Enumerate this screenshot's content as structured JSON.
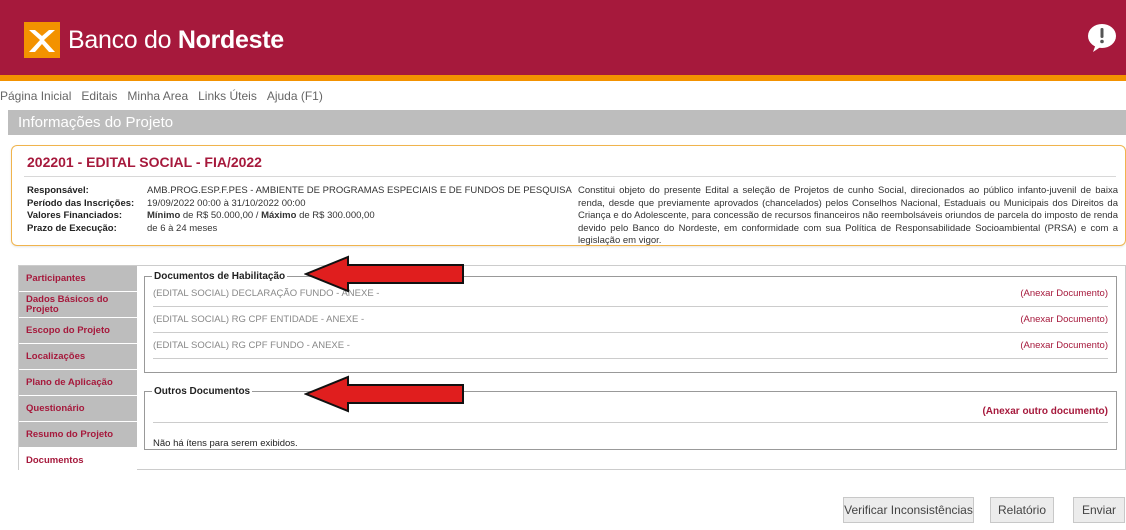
{
  "header": {
    "brand_regular": "Banco do ",
    "brand_bold": "Nordeste",
    "colors": {
      "primary": "#a6193c",
      "accent": "#f39200"
    },
    "help_icon": "speech-bubble-exclamation-icon"
  },
  "menu": {
    "items": [
      "Página Inicial",
      "Editais",
      "Minha Area",
      "Links Úteis",
      "Ajuda (F1)"
    ]
  },
  "page_title": "Informações do Projeto",
  "project": {
    "title": "202201 - EDITAL SOCIAL - FIA/2022",
    "responsavel_label": "Responsável:",
    "responsavel": "AMB.PROG.ESP.F.PES - AMBIENTE DE PROGRAMAS ESPECIAIS E DE FUNDOS DE PESQUISA",
    "periodo_label": "Período das Inscrições:",
    "periodo": "19/09/2022 00:00 à 31/10/2022 00:00",
    "valores_label": "Valores Financiados:",
    "valores_min_label": "Mínimo",
    "valores_min": " de R$ 50.000,00 / ",
    "valores_max_label": "Máximo",
    "valores_max": " de R$ 300.000,00",
    "prazo_label": "Prazo de Execução:",
    "prazo": "de 6 à 24 meses",
    "description": "Constitui objeto do presente Edital a seleção de Projetos de cunho Social, direcionados ao público infanto-juvenil de baixa renda, desde que previamente aprovados (chancelados) pelos Conselhos Nacional, Estaduais ou Municipais dos Direitos da Criança e do Adolescente, para concessão de recursos financeiros não reembolsáveis oriundos de parcela do imposto de renda devido pelo Banco do Nordeste, em conformidade com sua Política de Responsabilidade Socioambiental (PRSA) e com a legislação em vigor."
  },
  "tabs": [
    "Participantes",
    "Dados Básicos do Projeto",
    "Escopo do Projeto",
    "Localizações",
    "Plano de Aplicação",
    "Questionário",
    "Resumo do Projeto",
    "Documentos"
  ],
  "active_tab": "Documentos",
  "habilitacao": {
    "legend": "Documentos de Habilitação",
    "documents": [
      {
        "name": "(EDITAL SOCIAL) DECLARAÇÃO FUNDO - ANEXE  -",
        "action": "(Anexar Documento)"
      },
      {
        "name": "(EDITAL SOCIAL) RG CPF ENTIDADE - ANEXE  -",
        "action": "(Anexar Documento)"
      },
      {
        "name": "(EDITAL SOCIAL) RG CPF FUNDO - ANEXE  -",
        "action": "(Anexar Documento)"
      }
    ]
  },
  "outros": {
    "legend": "Outros Documentos",
    "action": "(Anexar outro documento)",
    "empty_message": "Não há ítens para serem exibidos."
  },
  "buttons": {
    "verificar": "Verificar Inconsistências",
    "relatorio": "Relatório",
    "enviar": "Enviar"
  }
}
